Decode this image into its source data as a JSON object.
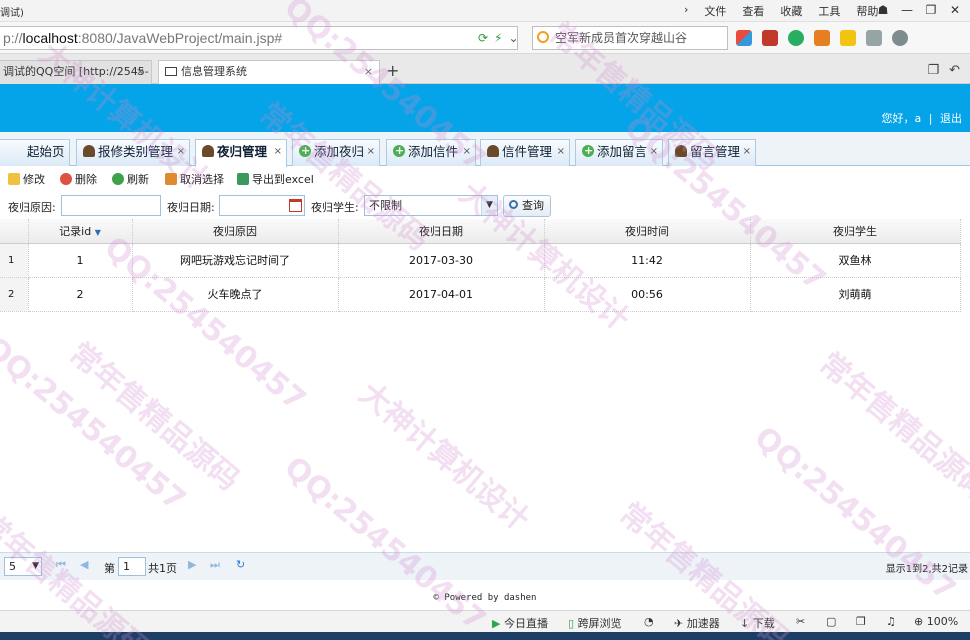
{
  "browser": {
    "title_fragment": "调试)",
    "menus": [
      "文件",
      "查看",
      "收藏",
      "工具",
      "帮助"
    ],
    "url_host": "localhost",
    "url_rest": ":8080/JavaWebProject/main.jsp#",
    "url_prefix": "p://",
    "search_text": "空军新成员首次穿越山谷",
    "tabs": [
      {
        "label": "调试的QQ空间 [http://2545-"
      },
      {
        "label": "信息管理系统"
      }
    ],
    "new_tab": "+"
  },
  "header": {
    "greeting": "您好，",
    "user": "a",
    "separator": "|",
    "logout": "退出"
  },
  "app_tabs": [
    {
      "label": "起始页"
    },
    {
      "label": "报修类别管理"
    },
    {
      "label": "夜归管理"
    },
    {
      "label": "添加夜归"
    },
    {
      "label": "添加信件"
    },
    {
      "label": "信件管理"
    },
    {
      "label": "添加留言"
    },
    {
      "label": "留言管理"
    }
  ],
  "toolbar": {
    "edit": "修改",
    "delete": "删除",
    "refresh": "刷新",
    "cancel_select": "取消选择",
    "export": "导出到excel"
  },
  "search": {
    "reason_label": "夜归原因:",
    "date_label": "夜归日期:",
    "student_label": "夜归学生:",
    "student_value": "不限制",
    "query_button": "查询"
  },
  "grid": {
    "columns": [
      "记录id",
      "夜归原因",
      "夜归日期",
      "夜归时间",
      "夜归学生"
    ],
    "rows": [
      {
        "rownum": "1",
        "id": "1",
        "reason": "网吧玩游戏忘记时间了",
        "date": "2017-03-30",
        "time": "11:42",
        "student": "双鱼林"
      },
      {
        "rownum": "2",
        "id": "2",
        "reason": "火车晚点了",
        "date": "2017-04-01",
        "time": "00:56",
        "student": "刘萌萌"
      }
    ]
  },
  "pager": {
    "page_size": "5",
    "page_prefix": "第",
    "page_value": "1",
    "page_total": "共1页",
    "info": "显示1到2,共2记录"
  },
  "footer": {
    "text": "© Powered by dashen"
  },
  "statusbar": {
    "live": "今日直播",
    "split": "跨屏浏览",
    "speed": "加速器",
    "download": "下载",
    "zoom": "100%"
  },
  "watermark": {
    "qq": "QQ:254540457",
    "design": "大神计算机设计",
    "source": "常年售精品源码"
  }
}
